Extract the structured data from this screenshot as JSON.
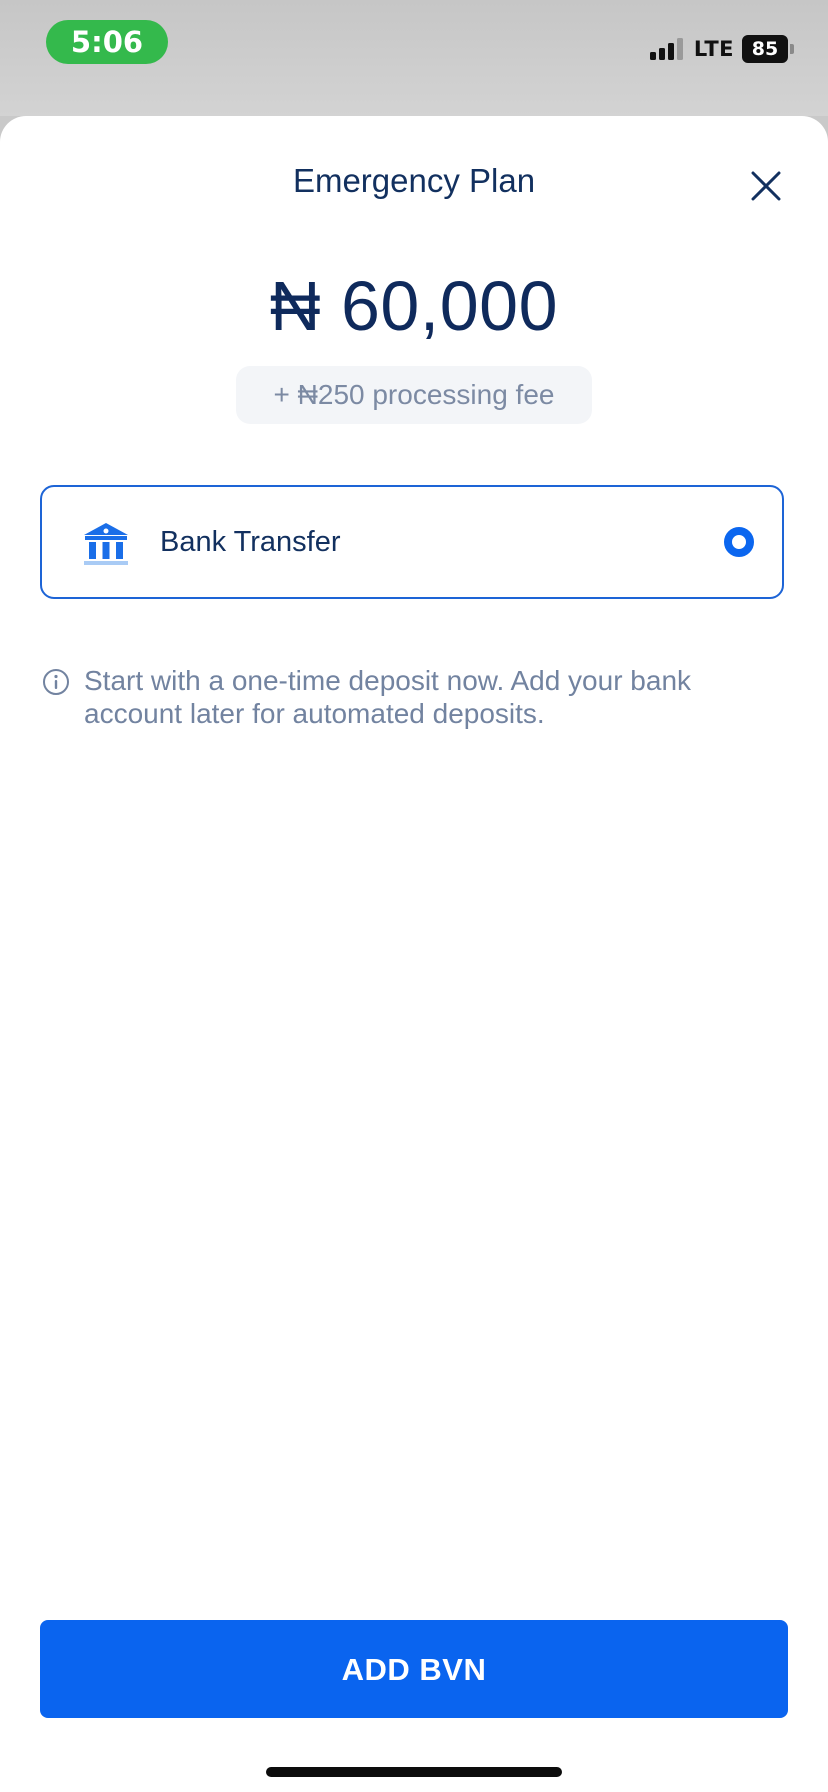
{
  "status_bar": {
    "time": "5:06",
    "network": "LTE",
    "battery": "85"
  },
  "sheet": {
    "title": "Emergency Plan",
    "amount": "₦ 60,000",
    "fee": "+ ₦250 processing fee",
    "payment_method": {
      "label": "Bank Transfer",
      "icon": "bank-icon",
      "selected": true
    },
    "info_text": "Start with a one-time deposit now. Add your bank account later for automated deposits.",
    "cta_label": "ADD BVN"
  },
  "colors": {
    "accent": "#0a64ef",
    "title_navy": "#12305f",
    "muted_text": "#7283a0",
    "status_pill_green": "#34b94c"
  }
}
